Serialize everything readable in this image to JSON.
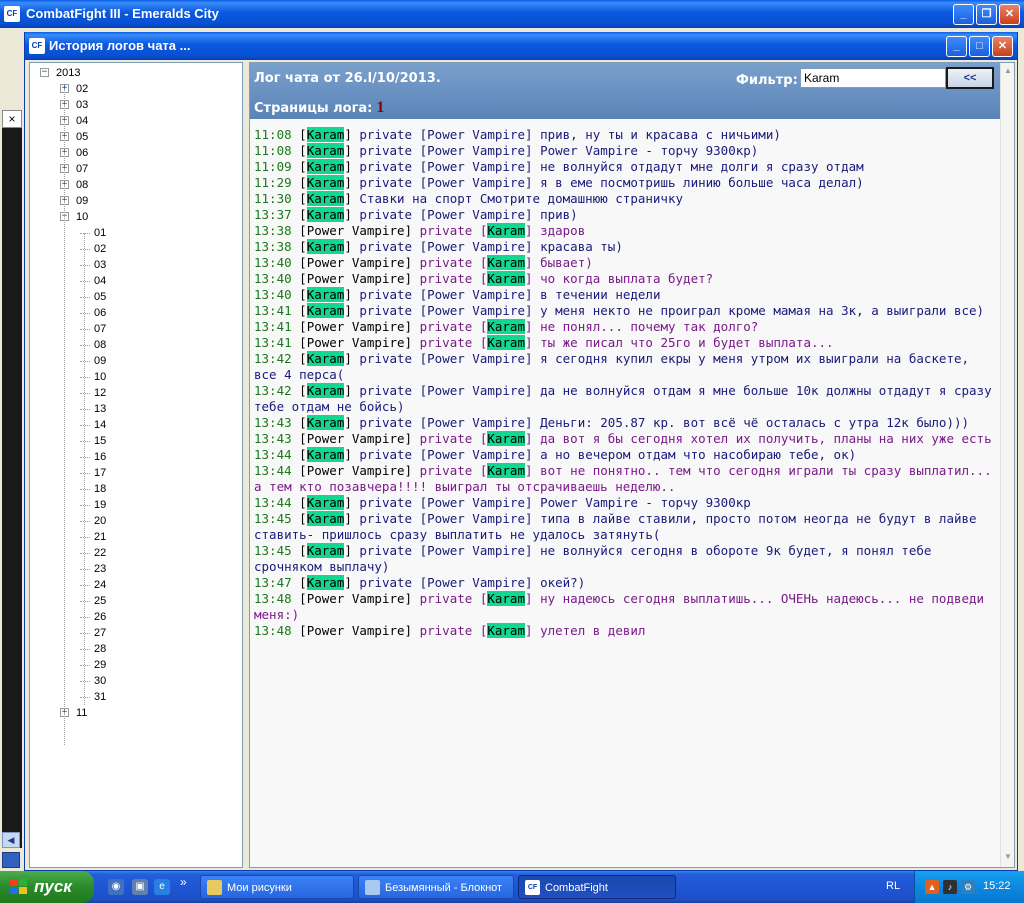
{
  "main_window": {
    "title": "CombatFight III - Emeralds City",
    "icon": "CF"
  },
  "dialog": {
    "title": "История логов чата ...",
    "icon": "CF",
    "buttons": {
      "minimize": "_",
      "maximize": "□",
      "close": "✕"
    }
  },
  "tree": {
    "year": "2013",
    "collapsed_before": [
      "02",
      "03",
      "04",
      "05",
      "06",
      "07",
      "08",
      "09"
    ],
    "expanded_month": "10",
    "days": [
      "01",
      "02",
      "03",
      "04",
      "05",
      "06",
      "07",
      "08",
      "09",
      "10",
      "12",
      "13",
      "14",
      "15",
      "16",
      "17",
      "18",
      "19",
      "20",
      "21",
      "22",
      "23",
      "24",
      "25",
      "26",
      "27",
      "28",
      "29",
      "30",
      "31"
    ],
    "collapsed_after": [
      "11"
    ],
    "plus": "+",
    "minus": "−"
  },
  "log": {
    "title": "Лог чата от 26.l/10/2013.",
    "filter_label": "Фильтр:",
    "filter_value": "Karam",
    "filter_button": "<<",
    "pages_label": "Страницы лога:",
    "page_number": "1",
    "lines": [
      {
        "time": "11:08",
        "from": "Karam",
        "to": "Power Vampire",
        "dir": "out",
        "text": "прив, ну ты и красава с ничьими)"
      },
      {
        "time": "11:08",
        "from": "Karam",
        "to": "Power Vampire",
        "dir": "out",
        "text": "Power Vampire - торчу 9300кр)"
      },
      {
        "time": "11:09",
        "from": "Karam",
        "to": "Power Vampire",
        "dir": "out",
        "text": "не волнуйся отдадут мне долги я сразу отдам"
      },
      {
        "time": "11:29",
        "from": "Karam",
        "to": "Power Vampire",
        "dir": "out",
        "text": "я в еме посмотришь линию больше часа делал)"
      },
      {
        "time": "11:30",
        "from": "Karam",
        "to": "",
        "dir": "out",
        "text": "Ставки на спорт Смотрите домашнюю страничку"
      },
      {
        "time": "13:37",
        "from": "Karam",
        "to": "Power Vampire",
        "dir": "out",
        "text": "прив)"
      },
      {
        "time": "13:38",
        "from": "Power Vampire",
        "to": "Karam",
        "dir": "in",
        "text": "здаров"
      },
      {
        "time": "13:38",
        "from": "Karam",
        "to": "Power Vampire",
        "dir": "out",
        "text": "красава ты)"
      },
      {
        "time": "13:40",
        "from": "Power Vampire",
        "to": "Karam",
        "dir": "in",
        "text": "бывает)"
      },
      {
        "time": "13:40",
        "from": "Power Vampire",
        "to": "Karam",
        "dir": "in",
        "text": "чо когда выплата будет?"
      },
      {
        "time": "13:40",
        "from": "Karam",
        "to": "Power Vampire",
        "dir": "out",
        "text": "в течении недели"
      },
      {
        "time": "13:41",
        "from": "Karam",
        "to": "Power Vampire",
        "dir": "out",
        "text": "у меня некто не проиграл кроме мамая на 3к, а выиграли все)"
      },
      {
        "time": "13:41",
        "from": "Power Vampire",
        "to": "Karam",
        "dir": "in",
        "text": "не понял... почему так долго?"
      },
      {
        "time": "13:41",
        "from": "Power Vampire",
        "to": "Karam",
        "dir": "in",
        "text": "ты же писал что 25го и будет выплата..."
      },
      {
        "time": "13:42",
        "from": "Karam",
        "to": "Power Vampire",
        "dir": "out",
        "text": "я сегодня купил екры у меня утром их выиграли на баскете, все 4 перса("
      },
      {
        "time": "13:42",
        "from": "Karam",
        "to": "Power Vampire",
        "dir": "out",
        "text": "да не волнуйся отдам я мне больше 10к должны отдадут я сразу тебе отдам не бойсь)"
      },
      {
        "time": "13:43",
        "from": "Karam",
        "to": "Power Vampire",
        "dir": "out",
        "text": "Деньги: 205.87 кр. вот всё чё осталась с утра 12к было)))"
      },
      {
        "time": "13:43",
        "from": "Power Vampire",
        "to": "Karam",
        "dir": "in",
        "text": "да вот я бы сегодня хотел их получить, планы на них уже есть"
      },
      {
        "time": "13:44",
        "from": "Karam",
        "to": "Power Vampire",
        "dir": "out",
        "text": "а но вечером отдам что насобираю тебе, ок)"
      },
      {
        "time": "13:44",
        "from": "Power Vampire",
        "to": "Karam",
        "dir": "in",
        "text": "вот не понятно.. тем что сегодня играли ты сразу выплатил... а тем кто позавчера!!!! выиграл ты отсрачиваешь неделю.."
      },
      {
        "time": "13:44",
        "from": "Karam",
        "to": "Power Vampire",
        "dir": "out",
        "text": "Power Vampire - торчу 9300кр"
      },
      {
        "time": "13:45",
        "from": "Karam",
        "to": "Power Vampire",
        "dir": "out",
        "text": "типа в лайве ставили, просто потом неогда не будут в лайве ставить- пришлось сразу выплатить не удалось затянуть("
      },
      {
        "time": "13:45",
        "from": "Karam",
        "to": "Power Vampire",
        "dir": "out",
        "text": "не волнуйся сегодня в обороте 9к будет, я понял тебе срочняком выплачу)"
      },
      {
        "time": "13:47",
        "from": "Karam",
        "to": "Power Vampire",
        "dir": "out",
        "text": "окей?)"
      },
      {
        "time": "13:48",
        "from": "Power Vampire",
        "to": "Karam",
        "dir": "in",
        "text": "ну надеюсь сегодня выплатишь... ОЧЕНь надеюсь... не подведи меня:)"
      },
      {
        "time": "13:48",
        "from": "Power Vampire",
        "to": "Karam",
        "dir": "in",
        "text": "улетел в девил"
      }
    ],
    "private_word": "private"
  },
  "taskbar": {
    "start_label": "пуск",
    "quicklaunch_more": "»",
    "tasks": [
      {
        "label": "Мои рисунки",
        "icon": "folder-icon",
        "color": "#e8c860"
      },
      {
        "label": "Безымянный - Блокнот",
        "icon": "notepad-icon",
        "color": "#a8c8f0"
      },
      {
        "label": "CombatFight",
        "icon": "cf-icon",
        "color": "#ffffff",
        "active": true
      }
    ],
    "language": "RL",
    "clock": "15:22"
  },
  "colors": {
    "highlight": "#10d890",
    "time": "#1a7a1a",
    "incoming": "#7a1a8a",
    "outgoing": "#1a1a7a"
  }
}
